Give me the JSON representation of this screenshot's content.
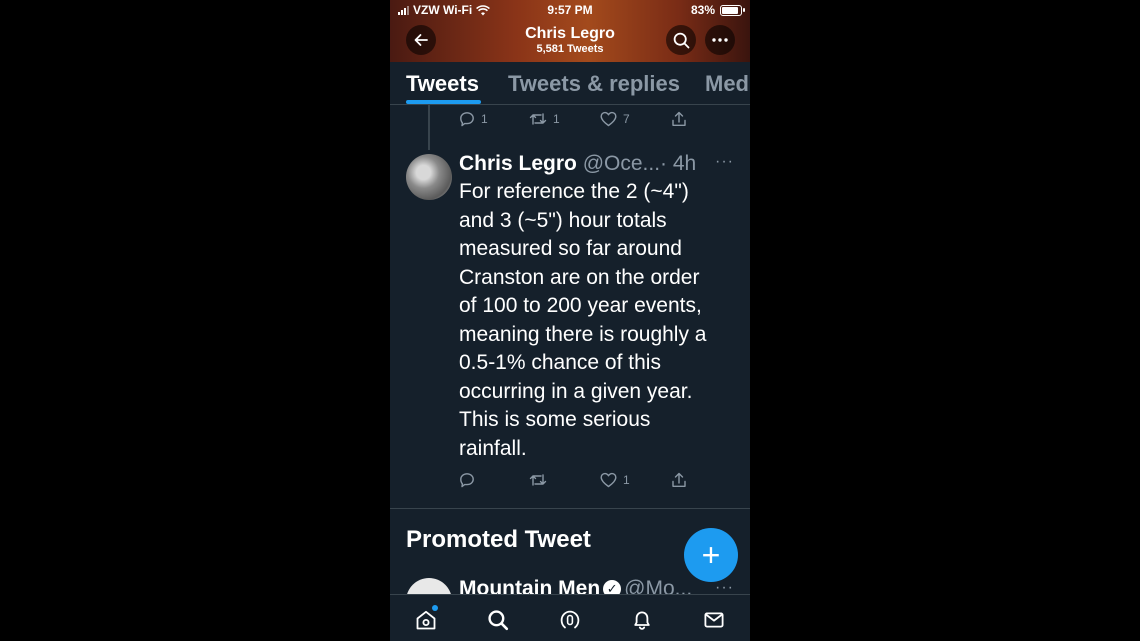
{
  "status_bar": {
    "carrier": "VZW Wi-Fi",
    "time": "9:57 PM",
    "battery": "83%"
  },
  "profile_header": {
    "name": "Chris Legro",
    "tweet_count": "5,581 Tweets"
  },
  "tabs": [
    {
      "label": "Tweets",
      "active": true
    },
    {
      "label": "Tweets & replies",
      "active": false
    },
    {
      "label": "Med",
      "active": false
    }
  ],
  "previous_tweet_actions": {
    "replies": "1",
    "retweets": "1",
    "likes": "7"
  },
  "tweet": {
    "name": "Chris Legro",
    "handle": "@Oce...",
    "time": "· 4h",
    "more": "···",
    "lines": [
      "For reference the 2 (~4\")",
      "and 3 (~5\") hour totals",
      "measured so far around",
      "Cranston are on the order",
      "of 100 to 200 year events,",
      "meaning there is roughly a",
      "0.5-1% chance of this",
      "occurring in a given year.",
      "This is some serious",
      "rainfall."
    ],
    "likes": "1"
  },
  "promoted": {
    "heading": "Promoted Tweet",
    "name": "Mountain Men",
    "handle": "@Mo...",
    "more": "···"
  },
  "fab": {
    "label": "+"
  },
  "colors": {
    "background": "#15202b",
    "accent": "#1d9bf0",
    "muted": "#8b98a5",
    "divider": "#38444d"
  },
  "icons": {
    "back": "arrow-left-icon",
    "search": "search-icon",
    "more": "more-horizontal-icon",
    "reply": "reply-icon",
    "retweet": "retweet-icon",
    "like": "heart-icon",
    "share": "share-icon",
    "home": "home-icon",
    "explore": "search-icon",
    "spaces": "spaces-icon",
    "notifications": "bell-icon",
    "messages": "mail-icon"
  }
}
